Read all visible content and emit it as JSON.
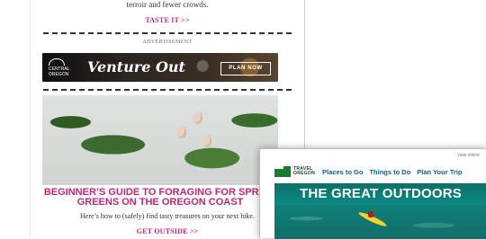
{
  "email": {
    "snippet": "terroir and fewer crowds.",
    "cta1": "TASTE IT >>",
    "ad_label": "ADVERTISEMENT",
    "ad": {
      "brand_line1": "CENTRAL",
      "brand_line2": "OREGON",
      "headline": "Venture Out",
      "button": "PLAN NOW"
    },
    "article": {
      "headline": "BEGINNER’S GUIDE TO FORAGING FOR SPRING GREENS ON THE OREGON COAST",
      "dek": "Here’s how to (safely) find tasty treasures on your next hike.",
      "cta": "GET OUTSIDE >>"
    }
  },
  "overlay": {
    "view_online": "view online",
    "brand_line1": "TRAVEL",
    "brand_line2": "OREGON",
    "nav": [
      "Places to Go",
      "Things to Do",
      "Plan Your Trip"
    ],
    "hero_title": "THE GREAT OUTDOORS"
  }
}
